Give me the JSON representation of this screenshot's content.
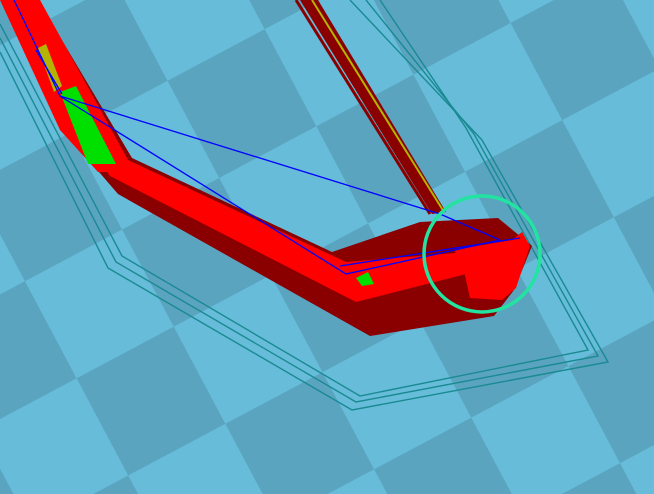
{
  "viewer": {
    "background": {
      "light_tile_color": "#66bcd9",
      "dark_tile_color": "#5aa4c0"
    },
    "model_colors": {
      "perimeter_outer": "#ff0000",
      "perimeter_shadow": "#8a0000",
      "infill": "#00e000",
      "travel_move": "#0000ff",
      "skirt": "#1a8a92",
      "support_edge": "#b4b400",
      "highlight_circle": "#22e4a0"
    },
    "layers": [
      {
        "name": "skirt-outline",
        "icon": "path-icon"
      },
      {
        "name": "perimeter",
        "icon": "wall-icon"
      },
      {
        "name": "infill",
        "icon": "fill-icon"
      },
      {
        "name": "travel",
        "icon": "move-icon"
      }
    ],
    "annotation": {
      "shape": "circle",
      "icon": "highlight-circle-icon"
    }
  }
}
